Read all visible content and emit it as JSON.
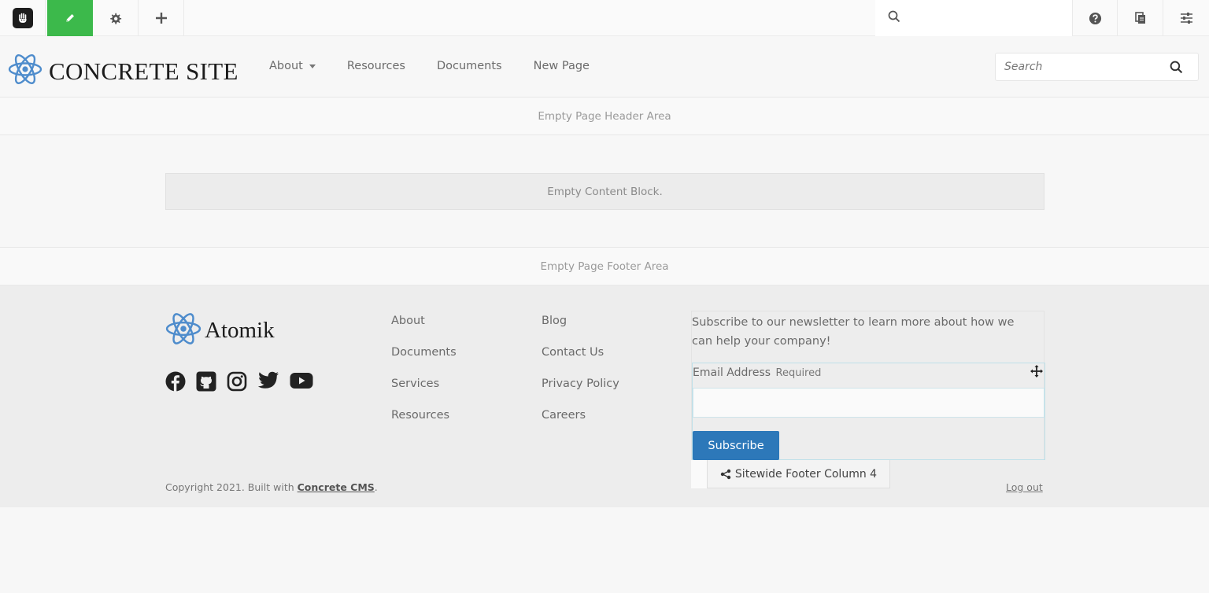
{
  "toolbar": {
    "logo_icon": "concrete-hand-icon",
    "edit_icon": "pencil-icon",
    "settings_icon": "gear-icon",
    "add_icon": "plus-icon",
    "search_icon": "search-icon",
    "search_placeholder": "",
    "help_icon": "question-circle-icon",
    "sitemap_icon": "pages-icon",
    "panel_icon": "sliders-icon",
    "edit_active_color": "#3cb94b"
  },
  "header": {
    "brand_name": "CONCRETE SITE",
    "nav": [
      {
        "label": "About",
        "has_dropdown": true
      },
      {
        "label": "Resources"
      },
      {
        "label": "Documents"
      },
      {
        "label": "New Page"
      }
    ],
    "search_placeholder": "Search"
  },
  "areas": {
    "header_area": "Empty Page Header Area",
    "content_block": "Empty Content Block.",
    "footer_area": "Empty Page Footer Area"
  },
  "footer": {
    "brand_name": "Atomik",
    "social": [
      "facebook-icon",
      "github-icon",
      "instagram-icon",
      "twitter-icon",
      "youtube-icon"
    ],
    "col1": [
      "About",
      "Documents",
      "Services",
      "Resources"
    ],
    "col2": [
      "Blog",
      "Contact Us",
      "Privacy Policy",
      "Careers"
    ],
    "newsletter": {
      "text": "Subscribe to our newsletter to learn more about how we can help your company!",
      "email_label": "Email Address",
      "required_label": "Required",
      "button_label": "Subscribe",
      "button_color": "#2d78b9"
    },
    "area_tag": "Sitewide Footer Column 4",
    "copyright_prefix": "Copyright 2021. Built with ",
    "copyright_link": "Concrete CMS",
    "copyright_suffix": ".",
    "logout": "Log out"
  }
}
